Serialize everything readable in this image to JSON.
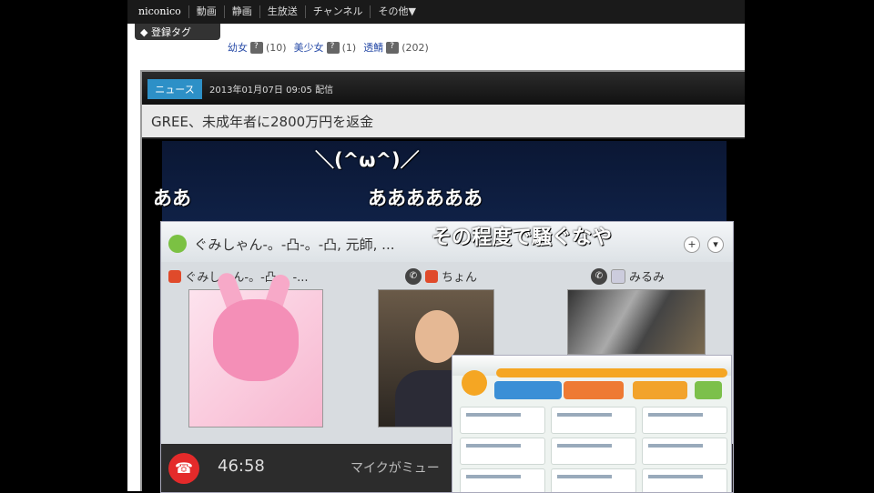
{
  "topnav": {
    "logo": "niconico",
    "items": [
      "動画",
      "静画",
      "生放送",
      "チャンネル",
      "その他▼"
    ]
  },
  "tags": {
    "button_label": "◆ 登録タグ",
    "items": [
      {
        "name": "幼女",
        "count": "(10)"
      },
      {
        "name": "美少女",
        "count": "(1)"
      },
      {
        "name": "透鯖",
        "count": "(202)"
      }
    ]
  },
  "news": {
    "badge": "ニュース",
    "date": "2013年01月07日 09:05 配信",
    "title": "GREE、未成年者に2800万円を返金"
  },
  "comments": [
    {
      "text": "＼(^ω^)／"
    },
    {
      "text": "ああ"
    },
    {
      "text": "ああああああ"
    },
    {
      "text": "その程度で騒ぐなや"
    }
  ],
  "skype": {
    "title": "ぐみしゃん-。-凸-。-凸, 元師, ...",
    "participants": [
      {
        "name": "ぐみしゃん-。-凸-。-..."
      },
      {
        "name": "ちょん"
      },
      {
        "name": "みるみ"
      }
    ],
    "timer": "46:58",
    "mute_text": "マイクがミュー"
  },
  "colors": {
    "news_badge": "#2d90c7",
    "skype_green": "#7bc143",
    "hangup_red": "#e42a2a"
  }
}
